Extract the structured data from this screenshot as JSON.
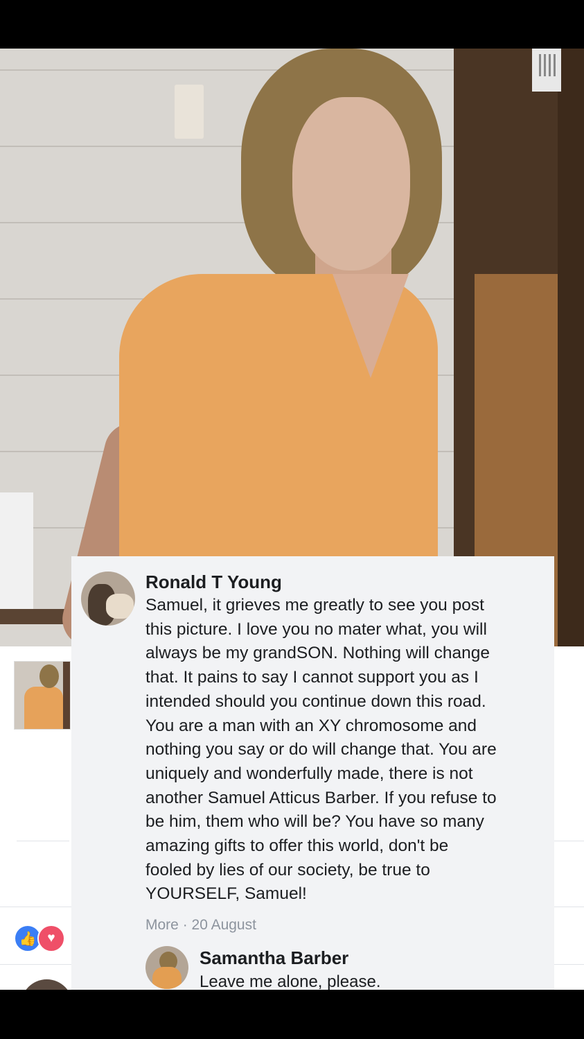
{
  "photo": {
    "alt": ""
  },
  "comment": {
    "author": "Ronald T Young",
    "lines": [
      "Samuel, it grieves me greatly to see you post",
      "this picture. I love you no mater what, you will",
      "always be my grandSON. Nothing will change",
      "that. It pains to say I cannot support you as I",
      "intended should you continue down this road.",
      "You are a man with an XY chromosome and",
      "nothing you say or do will change that. You are",
      "uniquely and wonderfully made, there is not",
      "another Samuel Atticus Barber. If you refuse to",
      "be him, them who will be? You have so many",
      "amazing gifts to offer this world, don't be",
      "fooled by lies of our society, be true to",
      "YOURSELF, Samuel!"
    ],
    "more_label": "More",
    "separator": " · ",
    "date": "20 August"
  },
  "reply": {
    "author": "Samantha Barber",
    "text": "Leave me alone, please."
  },
  "reactions": {
    "like_icon": "👍",
    "love_icon": "♥",
    "colors": {
      "like": "#3b7ef5",
      "love": "#ef4f68"
    }
  }
}
